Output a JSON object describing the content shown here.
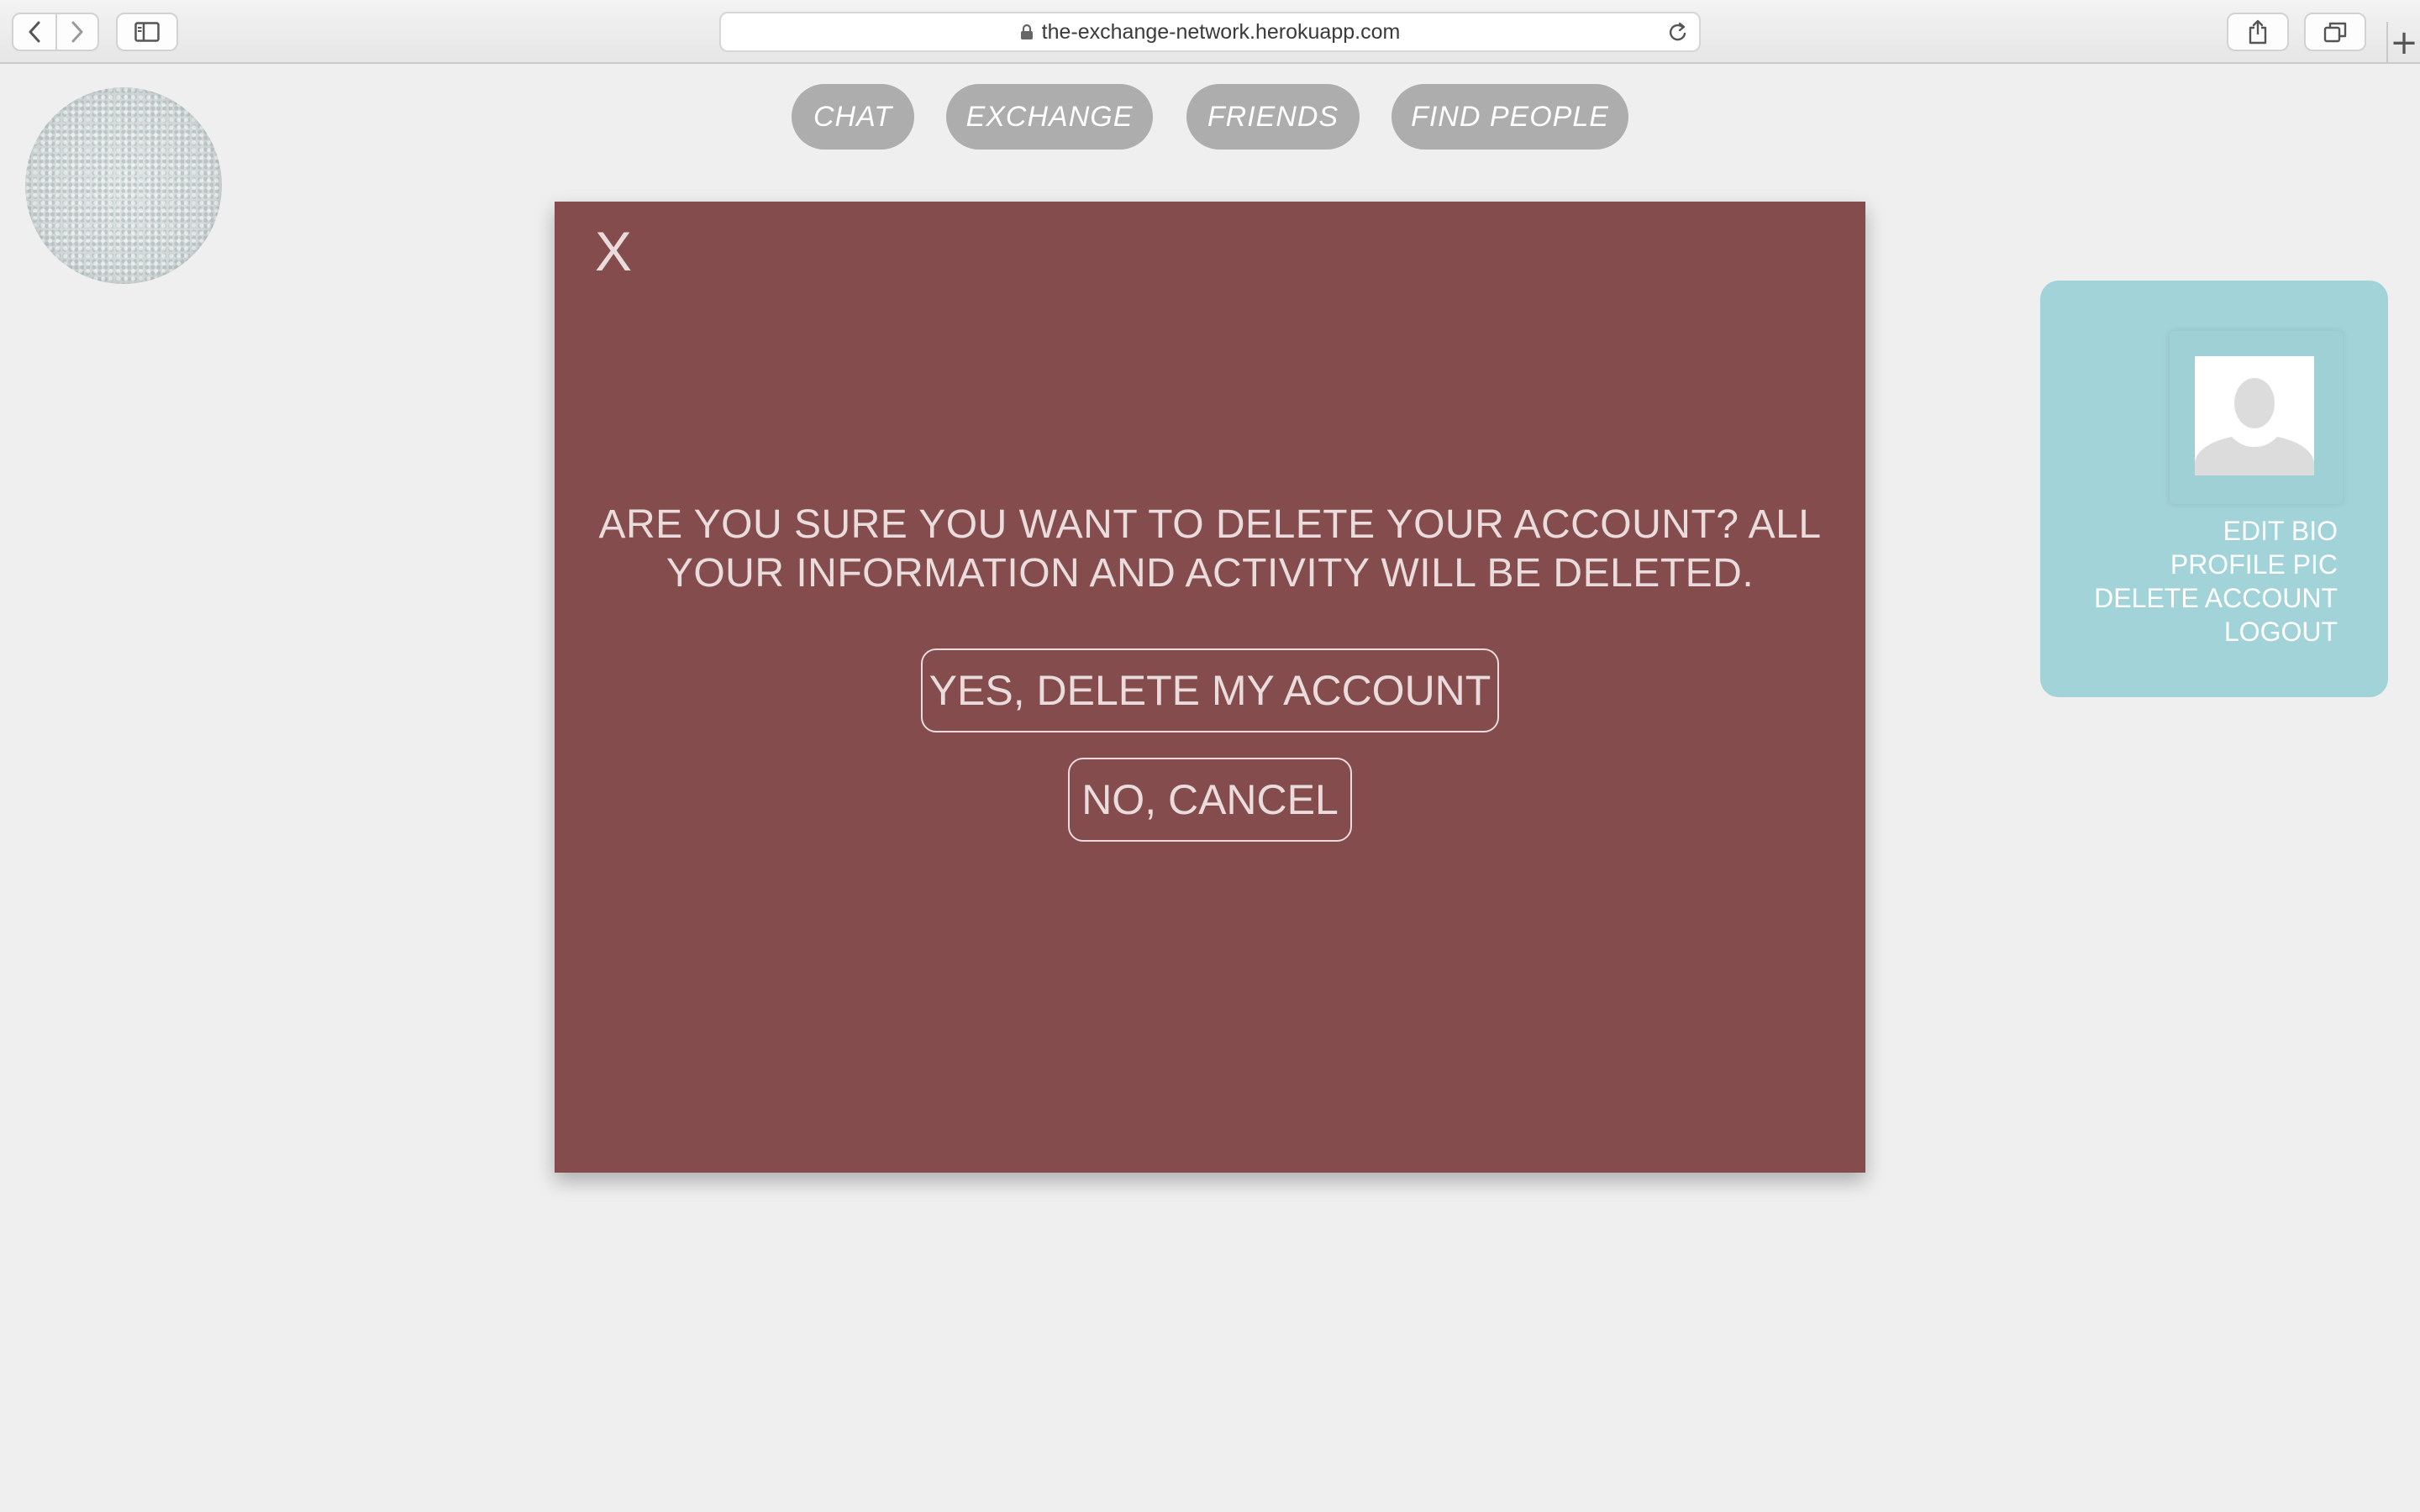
{
  "browser": {
    "url": "the-exchange-network.herokuapp.com",
    "back_icon": "chevron-left-icon",
    "forward_icon": "chevron-right-icon",
    "sidebar_icon": "sidebar-icon",
    "share_icon": "share-icon",
    "tabs_icon": "tabs-icon",
    "new_tab_label": "+"
  },
  "nav": {
    "items": [
      {
        "label": "CHAT"
      },
      {
        "label": "EXCHANGE"
      },
      {
        "label": "FRIENDS"
      },
      {
        "label": "FIND PEOPLE"
      }
    ]
  },
  "modal": {
    "close_label": "X",
    "message": "ARE YOU SURE YOU WANT TO DELETE YOUR ACCOUNT? ALL YOUR INFORMATION AND ACTIVITY WILL BE DELETED.",
    "confirm_label": "YES, DELETE MY ACCOUNT",
    "cancel_label": "NO, CANCEL"
  },
  "profile": {
    "menu": [
      {
        "label": "EDIT BIO"
      },
      {
        "label": "PROFILE PIC"
      },
      {
        "label": "DELETE ACCOUNT"
      },
      {
        "label": "LOGOUT"
      }
    ]
  },
  "colors": {
    "page_bg": "#efefef",
    "modal_bg": "#844c4d",
    "modal_text": "#eadcdc",
    "nav_pill": "#adadad",
    "profile_card": "#a2d3d9"
  }
}
